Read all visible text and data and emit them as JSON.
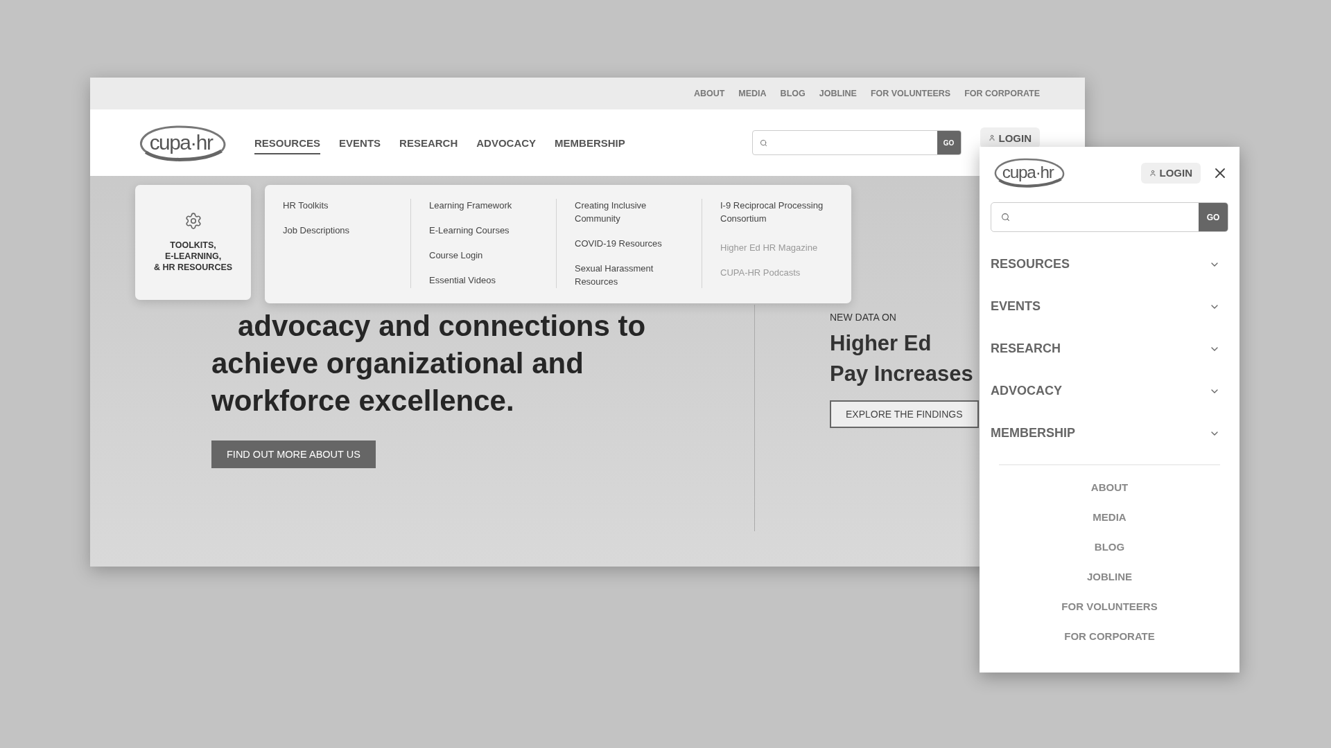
{
  "desktop": {
    "top_links": [
      "ABOUT",
      "MEDIA",
      "BLOG",
      "JOBLINE",
      "FOR VOLUNTEERS",
      "FOR CORPORATE"
    ],
    "logo": "cupa·hr",
    "nav": [
      {
        "label": "RESOURCES",
        "selected": true
      },
      {
        "label": "EVENTS",
        "selected": false
      },
      {
        "label": "RESEARCH",
        "selected": false
      },
      {
        "label": "ADVOCACY",
        "selected": false
      },
      {
        "label": "MEMBERSHIP",
        "selected": false
      }
    ],
    "search": {
      "button": "GO"
    },
    "login": "LOGIN",
    "mega_menu": {
      "feature": {
        "lines": [
          "TOOLKITS,",
          "E-LEARNING,",
          "& HR RESOURCES"
        ]
      },
      "columns": [
        {
          "items": [
            {
              "label": "HR Toolkits",
              "muted": false
            },
            {
              "label": "Job Descriptions",
              "muted": false
            }
          ]
        },
        {
          "items": [
            {
              "label": "Learning Framework",
              "muted": false
            },
            {
              "label": "E-Learning Courses",
              "muted": false
            },
            {
              "label": "Course Login",
              "muted": false
            },
            {
              "label": "Essential Videos",
              "muted": false
            }
          ]
        },
        {
          "items": [
            {
              "label": "Creating Inclusive Community",
              "muted": false
            },
            {
              "label": "COVID-19 Resources",
              "muted": false
            },
            {
              "label": "Sexual Harassment Resources",
              "muted": false
            }
          ]
        },
        {
          "items": [
            {
              "label": "I-9 Reciprocal Processing Consortium",
              "muted": false
            },
            {
              "label": "Higher Ed HR Magazine",
              "muted": true
            },
            {
              "label": "CUPA-HR Podcasts",
              "muted": true
            }
          ]
        }
      ]
    },
    "hero": {
      "heading_lines": [
        "advocacy and connections to",
        "achieve organizational and",
        "workforce excellence."
      ],
      "button": "FIND OUT MORE ABOUT US"
    },
    "promo": {
      "eyebrow": "NEW DATA ON",
      "title_lines": [
        "Higher Ed",
        "Pay Increases"
      ],
      "button": "EXPLORE THE FINDINGS"
    }
  },
  "mobile": {
    "logo": "cupa·hr",
    "login": "LOGIN",
    "search": {
      "button": "GO"
    },
    "nav": [
      {
        "label": "RESOURCES",
        "expanded": false
      },
      {
        "label": "EVENTS",
        "expanded": false
      },
      {
        "label": "RESEARCH",
        "expanded": false
      },
      {
        "label": "ADVOCACY",
        "expanded": false
      },
      {
        "label": "MEMBERSHIP",
        "expanded": false
      }
    ],
    "links": [
      "ABOUT",
      "MEDIA",
      "BLOG",
      "JOBLINE",
      "FOR VOLUNTEERS",
      "FOR CORPORATE"
    ]
  }
}
